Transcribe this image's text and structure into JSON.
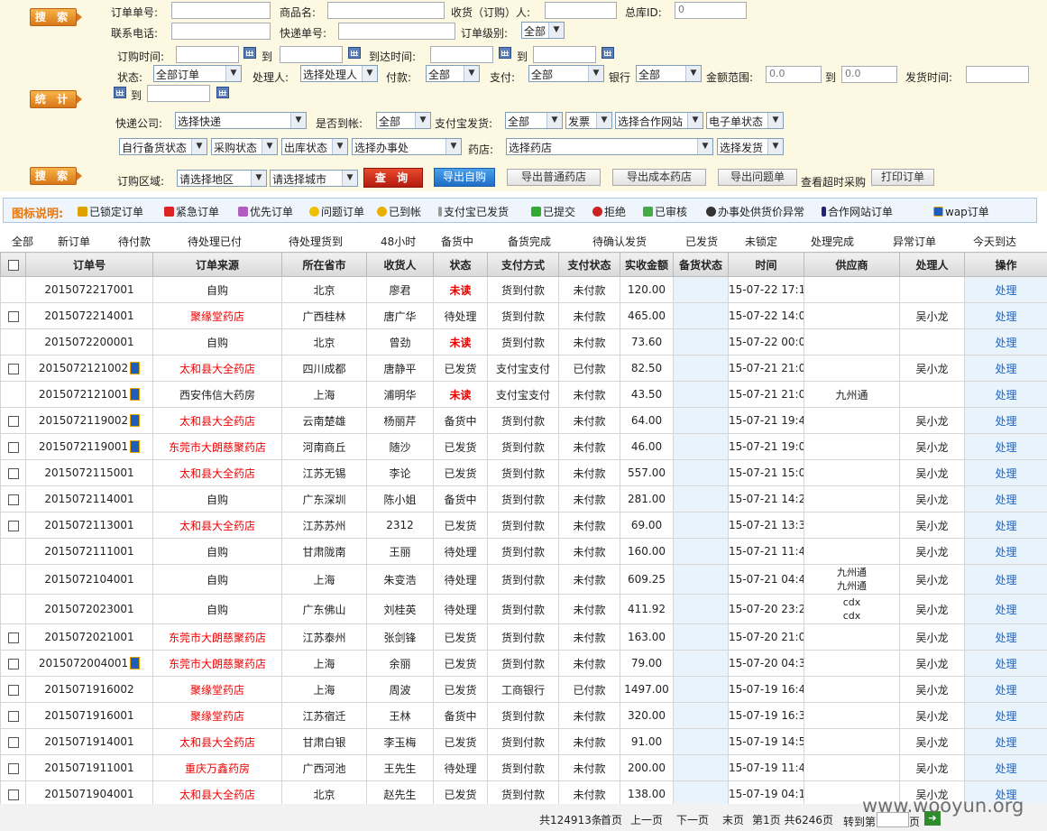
{
  "search": {
    "search_btn": "搜 索",
    "stats_btn": "统 计",
    "search_btn2": "搜 索",
    "order_no": "订单单号:",
    "product": "商品名:",
    "receiver": "收货（订购）人:",
    "hub_id": "总库ID:",
    "hub_id_value": "0",
    "phone": "联系电话:",
    "express_no": "快递单号:",
    "order_level": "订单级别:",
    "order_level_value": "全部",
    "order_time": "订购时间:",
    "to": "到",
    "arrive_time": "到达时间:",
    "status": "状态:",
    "status_value": "全部订单",
    "handler": "处理人:",
    "handler_value": "选择处理人",
    "pay": "付款:",
    "pay_value": "全部",
    "payment": "支付:",
    "payment_value": "全部",
    "bank": "银行",
    "bank_value": "全部",
    "amount": "金额范围:",
    "amount_from": "0.0",
    "amount_to": "0.0",
    "ship_time": "发货时间:",
    "courier": "快递公司:",
    "courier_value": "选择快递",
    "to_account": "是否到帐:",
    "to_account_value": "全部",
    "alipay_ship": "支付宝发货:",
    "alipay_value": "全部",
    "invoice_value": "发票",
    "partner_value": "选择合作网站",
    "eorder_value": "电子单状态",
    "self_stock_value": "自行备货状态",
    "purchase_value": "采购状态",
    "outbound_value": "出库状态",
    "office_value": "选择办事处",
    "pharmacy": "药店:",
    "pharmacy_value": "选择药店",
    "ship_value": "选择发货",
    "region": "订购区域:",
    "region_value": "请选择地区",
    "city_value": "请选择城市",
    "query": "查 询",
    "export_self": "导出自购",
    "export_normal": "导出普通药店",
    "export_cost": "导出成本药店",
    "export_issue": "导出问题单",
    "view_overtime": "查看超时采购",
    "print": "打印订单"
  },
  "legend": {
    "title": "图标说明:",
    "items": [
      "已锁定订单",
      "紧急订单",
      "优先订单",
      "问题订单",
      "已到帐",
      "支付宝已发货",
      "已提交",
      "拒绝",
      "已审核",
      "办事处供货价异常",
      "合作网站订单",
      "wap订单"
    ]
  },
  "quick": [
    "全部",
    "新订单",
    "待付款",
    "待处理已付",
    "待处理货到",
    "48小时",
    "备货中",
    "备货完成",
    "待确认发货",
    "已发货",
    "未锁定",
    "处理完成",
    "异常订单",
    "今天到达"
  ],
  "table": {
    "headers": [
      "订单号",
      "订单来源",
      "所在省市",
      "收货人",
      "状态",
      "支付方式",
      "支付状态",
      "实收金额",
      "备货状态",
      "时间",
      "供应商",
      "处理人",
      "操作"
    ],
    "rows": [
      [
        "2015072217001",
        "自购",
        "北京",
        "廖君",
        "未读",
        "货到付款",
        "未付款",
        "120.00",
        "",
        "15-07-22 17:13",
        "",
        "",
        "处理",
        0,
        0
      ],
      [
        "2015072214001",
        "聚缘堂药店",
        "广西桂林",
        "唐广华",
        "待处理",
        "货到付款",
        "未付款",
        "465.00",
        "",
        "15-07-22 14:06",
        "",
        "吴小龙",
        "处理",
        1,
        0
      ],
      [
        "2015072200001",
        "自购",
        "北京",
        "曾劲",
        "未读",
        "货到付款",
        "未付款",
        "73.60",
        "",
        "15-07-22 00:05",
        "",
        "",
        "处理",
        0,
        0
      ],
      [
        "2015072121002",
        "太和县大全药店",
        "四川成都",
        "唐静平",
        "已发货",
        "支付宝支付",
        "已付款",
        "82.50",
        "",
        "15-07-21 21:08",
        "",
        "吴小龙",
        "处理",
        1,
        1
      ],
      [
        "2015072121001",
        "西安伟信大药房",
        "上海",
        "浦明华",
        "未读",
        "支付宝支付",
        "未付款",
        "43.50",
        "",
        "15-07-21 21:04",
        "九州通",
        "",
        "处理",
        0,
        1
      ],
      [
        "2015072119002",
        "太和县大全药店",
        "云南楚雄",
        "杨丽芹",
        "备货中",
        "货到付款",
        "未付款",
        "64.00",
        "",
        "15-07-21 19:44",
        "",
        "吴小龙",
        "处理",
        1,
        1
      ],
      [
        "2015072119001",
        "东莞市大朗慈聚药店",
        "河南商丘",
        "随沙",
        "已发货",
        "货到付款",
        "未付款",
        "46.00",
        "",
        "15-07-21 19:07",
        "",
        "吴小龙",
        "处理",
        1,
        1
      ],
      [
        "2015072115001",
        "太和县大全药店",
        "江苏无锡",
        "李论",
        "已发货",
        "货到付款",
        "未付款",
        "557.00",
        "",
        "15-07-21 15:03",
        "",
        "吴小龙",
        "处理",
        1,
        0
      ],
      [
        "2015072114001",
        "自购",
        "广东深圳",
        "陈小姐",
        "备货中",
        "货到付款",
        "未付款",
        "281.00",
        "",
        "15-07-21 14:20",
        "",
        "吴小龙",
        "处理",
        1,
        0
      ],
      [
        "2015072113001",
        "太和县大全药店",
        "江苏苏州",
        "2312",
        "已发货",
        "货到付款",
        "未付款",
        "69.00",
        "",
        "15-07-21 13:35",
        "",
        "吴小龙",
        "处理",
        1,
        0
      ],
      [
        "2015072111001",
        "自购",
        "甘肃陇南",
        "王丽",
        "待处理",
        "货到付款",
        "未付款",
        "160.00",
        "",
        "15-07-21 11:49",
        "",
        "吴小龙",
        "处理",
        0,
        0
      ],
      [
        "2015072104001",
        "自购",
        "上海",
        "朱变浩",
        "待处理",
        "货到付款",
        "未付款",
        "609.25",
        "",
        "15-07-21 04:41",
        "九州通 九州通",
        "吴小龙",
        "处理",
        0,
        0
      ],
      [
        "2015072023001",
        "自购",
        "广东佛山",
        "刘桂英",
        "待处理",
        "货到付款",
        "未付款",
        "411.92",
        "",
        "15-07-20 23:20",
        "cdx cdx",
        "吴小龙",
        "处理",
        0,
        0
      ],
      [
        "2015072021001",
        "东莞市大朗慈聚药店",
        "江苏泰州",
        "张剑锋",
        "已发货",
        "货到付款",
        "未付款",
        "163.00",
        "",
        "15-07-20 21:01",
        "",
        "吴小龙",
        "处理",
        1,
        0
      ],
      [
        "2015072004001",
        "东莞市大朗慈聚药店",
        "上海",
        "余丽",
        "已发货",
        "货到付款",
        "未付款",
        "79.00",
        "",
        "15-07-20 04:35",
        "",
        "吴小龙",
        "处理",
        1,
        1
      ],
      [
        "2015071916002",
        "聚缘堂药店",
        "上海",
        "周波",
        "已发货",
        "工商银行",
        "已付款",
        "1497.00",
        "",
        "15-07-19 16:48",
        "",
        "吴小龙",
        "处理",
        1,
        0
      ],
      [
        "2015071916001",
        "聚缘堂药店",
        "江苏宿迁",
        "王林",
        "备货中",
        "货到付款",
        "未付款",
        "320.00",
        "",
        "15-07-19 16:37",
        "",
        "吴小龙",
        "处理",
        1,
        0
      ],
      [
        "2015071914001",
        "太和县大全药店",
        "甘肃白银",
        "李玉梅",
        "已发货",
        "货到付款",
        "未付款",
        "91.00",
        "",
        "15-07-19 14:59",
        "",
        "吴小龙",
        "处理",
        1,
        0
      ],
      [
        "2015071911001",
        "重庆万鑫药房",
        "广西河池",
        "王先生",
        "待处理",
        "货到付款",
        "未付款",
        "200.00",
        "",
        "15-07-19 11:44",
        "",
        "吴小龙",
        "处理",
        1,
        0
      ],
      [
        "2015071904001",
        "太和县大全药店",
        "北京",
        "赵先生",
        "已发货",
        "货到付款",
        "未付款",
        "138.00",
        "",
        "15-07-19 04:14",
        "",
        "吴小龙",
        "处理",
        1,
        0
      ]
    ]
  },
  "pager": {
    "total": "共124913条",
    "first": "首页",
    "prev": "上一页",
    "next": "下一页",
    "last": "末页",
    "info": "第1页 共6246页",
    "goto": "转到第",
    "page_unit": "页"
  },
  "watermark": "www.wooyun.org"
}
